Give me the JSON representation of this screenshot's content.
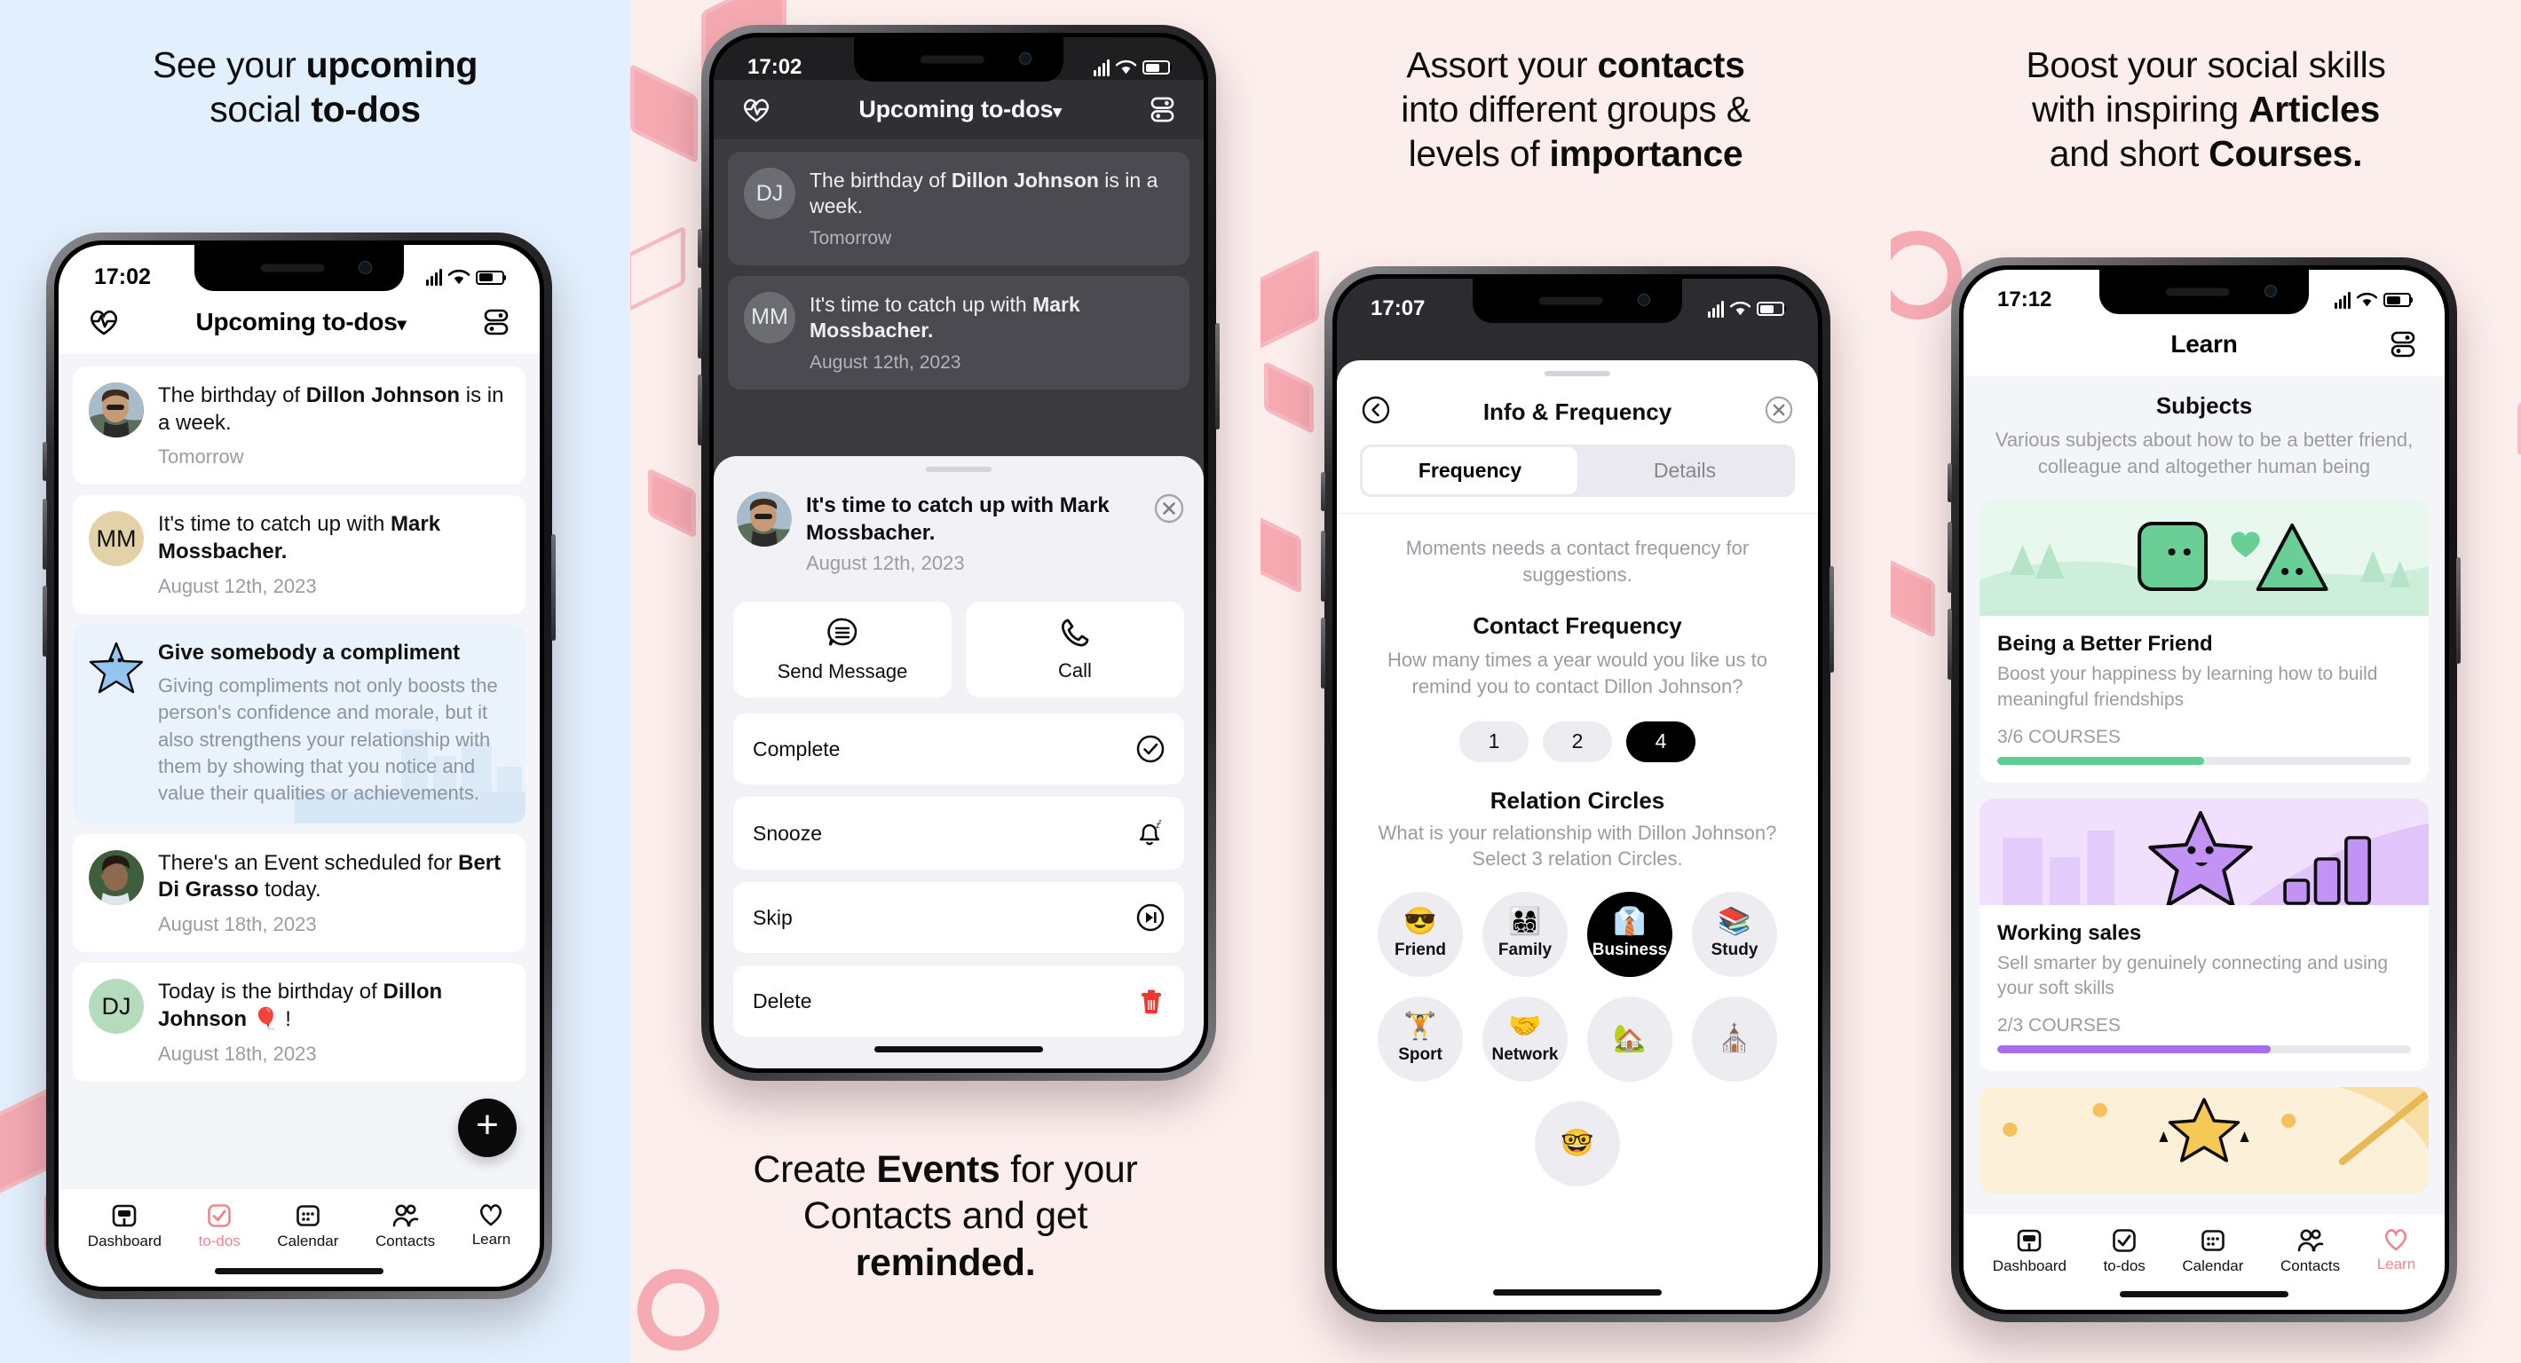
{
  "panels": [
    {
      "headline_html": "See your <b>upcoming</b><br>social <b>to-dos</b>",
      "bg": "#e2f0fd"
    },
    {
      "caption_html": "Create <b>Events</b> for your<br>Contacts and get<br><b>reminded.</b>",
      "bg": "#fdeeee"
    },
    {
      "headline_html": "Assort your <b>contacts</b><br>into different groups &amp;<br>levels of <b>importance</b>",
      "bg": "#fdeeee"
    },
    {
      "headline_html": "Boost your social skills<br>with inspiring <b>Articles</b><br>and short <b>Courses.</b>",
      "bg": "#fdeeee"
    }
  ],
  "phone1": {
    "status": {
      "time": "17:02",
      "signal_icon": "cellular-bars-icon",
      "wifi_icon": "wifi-icon",
      "battery_icon": "battery-icon"
    },
    "appbar": {
      "left_icon": "heartbeat-logo-icon",
      "title": "Upcoming to-dos",
      "chevron": "▾",
      "right_icon": "filter-list-icon"
    },
    "cards": [
      {
        "avatar_type": "photo",
        "avatar_photo": "man-sunglasses-photo",
        "main_pre": "The birthday of ",
        "main_bold": "Dillon Johnson",
        "main_post": " is in a week.",
        "sub": "Tomorrow"
      },
      {
        "avatar_type": "initials",
        "initials": "MM",
        "avatar_color": "#e3d1a8",
        "main_pre": "It's time to catch up with ",
        "main_bold": "Mark Mossbacher.",
        "main_post": "",
        "sub": "August 12th, 2023"
      },
      {
        "avatar_type": "star",
        "tip": true,
        "title": "Give somebody a compliment",
        "desc": "Giving compliments not only boosts the person's confidence and morale, but it also strengthens your relationship with them by showing that you notice and value their qualities or achievements."
      },
      {
        "avatar_type": "photo",
        "avatar_photo": "woman-phone-photo",
        "main_pre": "There's an Event scheduled for ",
        "main_bold": "Bert Di Grasso",
        "main_post": " today.",
        "sub": "August 18th, 2023"
      },
      {
        "avatar_type": "initials",
        "initials": "DJ",
        "avatar_color": "#b5dbbd",
        "main_pre": "Today is the birthday of ",
        "main_bold": "Dillon Johnson",
        "main_post": " 🎈 !",
        "sub": "August 18th, 2023"
      }
    ],
    "fab_label": "+",
    "tabs": [
      {
        "label": "Dashboard",
        "icon": "dashboard-icon",
        "active": false
      },
      {
        "label": "to-dos",
        "icon": "checkbox-icon",
        "active": true
      },
      {
        "label": "Calendar",
        "icon": "calendar-icon",
        "active": false
      },
      {
        "label": "Contacts",
        "icon": "people-icon",
        "active": false
      },
      {
        "label": "Learn",
        "icon": "heart-icon",
        "active": false
      }
    ]
  },
  "phone2": {
    "status": {
      "time": "17:02"
    },
    "appbar": {
      "left_icon": "heartbeat-logo-icon",
      "title": "Upcoming to-dos",
      "chevron": "▾",
      "right_icon": "filter-list-icon"
    },
    "cards": [
      {
        "avatar_type": "initials",
        "initials": "DJ",
        "avatar_color": "#d7d7dd",
        "main_pre": "The birthday of ",
        "main_bold": "Dillon Johnson",
        "main_post": " is in a week.",
        "sub": "Tomorrow"
      },
      {
        "avatar_type": "initials",
        "initials": "MM",
        "avatar_color": "#d7d7dd",
        "main_pre": "It's time to catch up with ",
        "main_bold": "Mark Mossbacher.",
        "main_post": "",
        "sub": "August 12th, 2023"
      }
    ],
    "sheet": {
      "close_icon": "close-circle-icon",
      "title_pre": "It's time to catch up with ",
      "title_bold": "Mark Mossbacher.",
      "subtitle": "August 12th, 2023",
      "quick_actions": [
        {
          "label": "Send Message",
          "icon": "message-bubble-icon"
        },
        {
          "label": "Call",
          "icon": "phone-icon"
        }
      ],
      "rows": [
        {
          "label": "Complete",
          "icon": "check-circle-icon",
          "color": "#111111"
        },
        {
          "label": "Snooze",
          "icon": "bell-snooze-icon",
          "color": "#111111"
        },
        {
          "label": "Skip",
          "icon": "skip-forward-icon",
          "color": "#111111"
        },
        {
          "label": "Delete",
          "icon": "trash-icon",
          "color": "#f4352e"
        }
      ]
    }
  },
  "phone3": {
    "status": {
      "time": "17:07"
    },
    "sheet_header": {
      "back_icon": "back-circle-icon",
      "title": "Info & Frequency",
      "close_icon": "close-circle-icon"
    },
    "tabs": [
      {
        "label": "Frequency",
        "active": true
      },
      {
        "label": "Details",
        "active": false
      }
    ],
    "intro": "Moments needs a contact frequency for suggestions.",
    "frequency": {
      "title": "Contact Frequency",
      "question": "How many times a year would you like us to remind you to contact Dillon Johnson?",
      "options": [
        "1",
        "2",
        "4"
      ],
      "selected": "4"
    },
    "relation": {
      "title": "Relation Circles",
      "question_line1": "What is your relationship with Dillon Johnson?",
      "question_line2": "Select 3 relation Circles.",
      "circles": [
        {
          "label": "Friend",
          "emoji": "😎",
          "selected": false
        },
        {
          "label": "Family",
          "emoji": "👨‍👩‍👧‍👦",
          "selected": false
        },
        {
          "label": "Business",
          "emoji": "👔",
          "selected": true
        },
        {
          "label": "Study",
          "emoji": "📚",
          "selected": false
        },
        {
          "label": "Sport",
          "emoji": "🏋️",
          "selected": false
        },
        {
          "label": "Network",
          "emoji": "🤝",
          "selected": false
        },
        {
          "label": "",
          "emoji": "🏡",
          "selected": false
        },
        {
          "label": "",
          "emoji": "⛪",
          "selected": false
        },
        {
          "label": "",
          "emoji": "🤓",
          "selected": false
        }
      ]
    }
  },
  "phone4": {
    "status": {
      "time": "17:12"
    },
    "appbar": {
      "title": "Learn",
      "right_icon": "filter-list-icon"
    },
    "section": {
      "title": "Subjects",
      "subtitle": "Various subjects about how to be a better friend, colleague and altogether human being"
    },
    "subjects": [
      {
        "title": "Being a Better Friend",
        "desc": "Boost your happiness by learning how to build meaningful friendships",
        "progress_label": "3/6 COURSES",
        "progress_pct": 50,
        "accent": "#5fce91",
        "hero_bg": "#e8f8ee",
        "hero_icon": "green-shapes-illustration"
      },
      {
        "title": "Working sales",
        "desc": "Sell smarter by genuinely connecting and using your soft skills",
        "progress_label": "2/3 COURSES",
        "progress_pct": 66,
        "accent": "#a86cf0",
        "hero_bg": "#f0dffd",
        "hero_icon": "purple-star-chart-illustration"
      },
      {
        "title": "",
        "desc": "",
        "progress_label": "",
        "progress_pct": 0,
        "accent": "#f5c451",
        "hero_bg": "#fdf0d8",
        "hero_icon": "yellow-star-illustration"
      }
    ],
    "tabs": [
      {
        "label": "Dashboard",
        "icon": "dashboard-icon",
        "active": false
      },
      {
        "label": "to-dos",
        "icon": "checkbox-icon",
        "active": false
      },
      {
        "label": "Calendar",
        "icon": "calendar-icon",
        "active": false
      },
      {
        "label": "Contacts",
        "icon": "people-icon",
        "active": false
      },
      {
        "label": "Learn",
        "icon": "heart-icon",
        "active": true
      }
    ]
  },
  "colors": {
    "accent_pink": "#f4848c",
    "delete_red": "#f4352e",
    "panel_blue": "#e2f0fd",
    "panel_pink": "#fdeeee"
  }
}
